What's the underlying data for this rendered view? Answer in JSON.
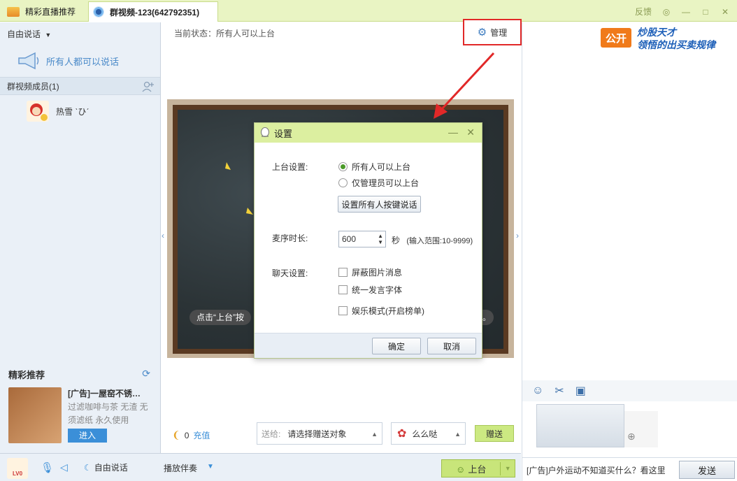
{
  "titlebar": {
    "tab1_label": "精彩直播推荐",
    "tab2_label": "群视频-123(642792351)",
    "feedback": "反馈"
  },
  "left": {
    "mode": "自由说话",
    "everyone_can_speak": "所有人都可以说话",
    "members_header": "群视频成员(1)",
    "member_name": "热雪 ˋひˊ",
    "recommend_title": "精彩推荐",
    "ad_title": "[广告]一屋窑不锈…",
    "ad_desc": "过滤咖啡与茶 无渣 无须滤纸 永久使用",
    "enter": "进入"
  },
  "center": {
    "status": "当前状态：所有人可以上台",
    "manage": "管理",
    "hint_left": "点击“上台”按",
    "hint_right": "。"
  },
  "dialog": {
    "title": "设置",
    "stage_label": "上台设置:",
    "opt_all": "所有人可以上台",
    "opt_admin": "仅管理员可以上台",
    "push_to_talk": "设置所有人按键说话",
    "mic_label": "麦序时长:",
    "mic_value": "600",
    "mic_unit": "秒",
    "mic_range": "(输入范围:10-9999)",
    "chat_label": "聊天设置:",
    "chk_block_img": "屏蔽图片消息",
    "chk_unify_font": "统一发言字体",
    "chk_fun_mode": "娱乐模式(开启榜单)",
    "ok": "确定",
    "cancel": "取消"
  },
  "gift": {
    "coin_count": "0",
    "charge": "充值",
    "to_prefix": "送给:",
    "to_placeholder": "请选择赠送对象",
    "gift_name": "么么哒",
    "send": "赠送"
  },
  "bottom": {
    "level": "LV0",
    "free_talk": "自由说话",
    "bgm": "播放伴奏",
    "stage_up": "上台"
  },
  "right": {
    "ad_badge": "公开",
    "ad_line1": "炒股天才",
    "ad_line2": "领悟的出买卖规律",
    "chat_ad": "[广告]户外运动不知道买什么？看这里",
    "send": "发送"
  }
}
